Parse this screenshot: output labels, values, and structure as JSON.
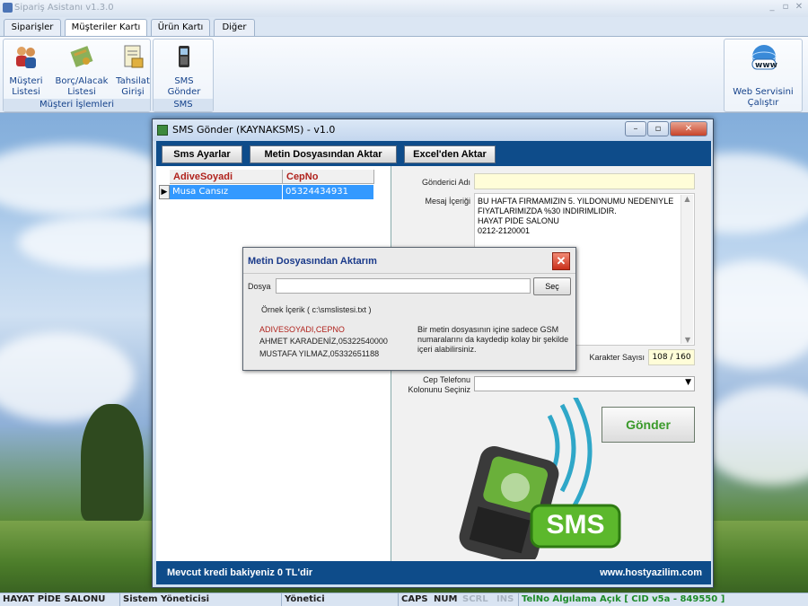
{
  "app": {
    "title": "Sipariş Asistanı v1.3.0"
  },
  "tabs": [
    "Siparişler",
    "Müşteriler Kartı",
    "Ürün Kartı",
    "Diğer"
  ],
  "ribbon": {
    "buttons": [
      {
        "label1": "Müşteri",
        "label2": "Listesi",
        "icon": "customers-icon"
      },
      {
        "label1": "Borç/Alacak",
        "label2": "Listesi",
        "icon": "ledger-icon"
      },
      {
        "label1": "Tahsilat",
        "label2": "Girişi",
        "icon": "payment-icon"
      },
      {
        "label1": "SMS",
        "label2": "Gönder",
        "icon": "phone-icon"
      }
    ],
    "groups": [
      "Müşteri İşlemleri",
      "SMS"
    ],
    "web_service": {
      "label1": "Web Servisini",
      "label2": "Çalıştır",
      "icon_text": "www"
    }
  },
  "sms_window": {
    "title": "SMS Gönder (KAYNAKSMS) - v1.0",
    "toolbar": [
      "Sms Ayarlar",
      "Metin Dosyasından Aktar",
      "Excel'den Aktar"
    ],
    "grid": {
      "columns": [
        "AdiveSoyadi",
        "CepNo"
      ],
      "rows": [
        [
          "Musa Cansız",
          "05324434931"
        ]
      ]
    },
    "sender_label": "Gönderici Adı",
    "sender_value": "",
    "message_label": "Mesaj İçeriği",
    "message": "BU HAFTA FIRMAMIZIN 5. YILDONUMU NEDENIYLE\nFIYATLARIMIZDA %30 INDIRIMLIDIR.\nHAYAT PIDE SALONU\n0212-2120001",
    "char_count_label": "Karakter Sayısı",
    "char_count": "108 / 160",
    "phone_column_label1": "Cep Telefonu",
    "phone_column_label2": "Kolonunu Seçiniz",
    "send_button": "Gönder",
    "sms_graphic_text": "SMS",
    "credit": "Mevcut kredi bakiyeniz 0 TL'dir",
    "website": "www.hostyazilim.com"
  },
  "import_dialog": {
    "title": "Metin Dosyasından Aktarım",
    "file_label": "Dosya",
    "file_value": "",
    "browse_button": "Seç",
    "sample_title": "Örnek İçerik ( c:\\smslistesi.txt )",
    "sample_header": "ADIVESOYADI,CEPNO",
    "sample_line1": "AHMET KARADENİZ,05322540000",
    "sample_line2": "MUSTAFA YILMAZ,05332651188",
    "hint": "Bir metin dosyasının içine sadece GSM numaralarını  da kaydedip kolay bir şekilde  içeri alabilirsiniz."
  },
  "statusbar": [
    "HAYAT PİDE SALONU",
    "Sistem Yöneticisi",
    "Yönetici",
    "CAPS",
    "NUM",
    "SCRL",
    "INS",
    "TelNo Algılama Açık [ CID v5a  - 849550 ]"
  ],
  "colors": {
    "accent": "#0e4c8a",
    "header_red": "#b0221c",
    "selection": "#3399ff",
    "status_green": "#1d8a2a"
  }
}
